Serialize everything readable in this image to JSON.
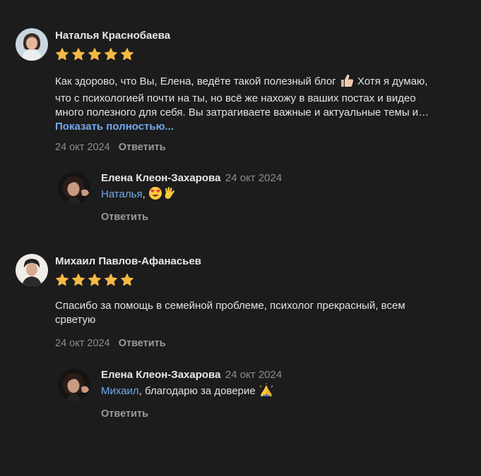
{
  "reviews": [
    {
      "author": "Наталья Краснобаева",
      "rating": 5,
      "text_part1": "Как здорово, что Вы, Елена, ведёте такой полезный блог",
      "emoji1": "thumbs-up",
      "text_part2": " Хотя я думаю,",
      "text_line2": "что с психологией почти на ты, но всё же нахожу в ваших постах и видео",
      "text_line3": "много полезного для себя. Вы затрагиваете важные и актуальные темы и…",
      "show_more": "Показать полностью...",
      "date": "24 окт 2024",
      "reply_action": "Ответить",
      "reply": {
        "author": "Елена Клеон-Захарова",
        "date": "24 окт 2024",
        "mention": "Наталья",
        "text": ",",
        "emojis": [
          "heart-eyes",
          "waving-hand"
        ],
        "action": "Ответить"
      }
    },
    {
      "author": "Михаил Павлов-Афанасьев",
      "rating": 5,
      "text_line1": "Спасибо за помощь в семейной проблеме, психолог прекрасный, всем",
      "text_line2": "срветую",
      "date": "24 окт 2024",
      "reply_action": "Ответить",
      "reply": {
        "author": "Елена Клеон-Захарова",
        "date": "24 окт 2024",
        "mention": "Михаил",
        "text": ", благодарю за доверие",
        "emojis": [
          "folded-hands"
        ],
        "action": "Ответить"
      }
    }
  ],
  "colors": {
    "background": "#1c1c1d",
    "link": "#71aaeb",
    "star": "#f5b944",
    "muted": "#8d8d8d"
  }
}
